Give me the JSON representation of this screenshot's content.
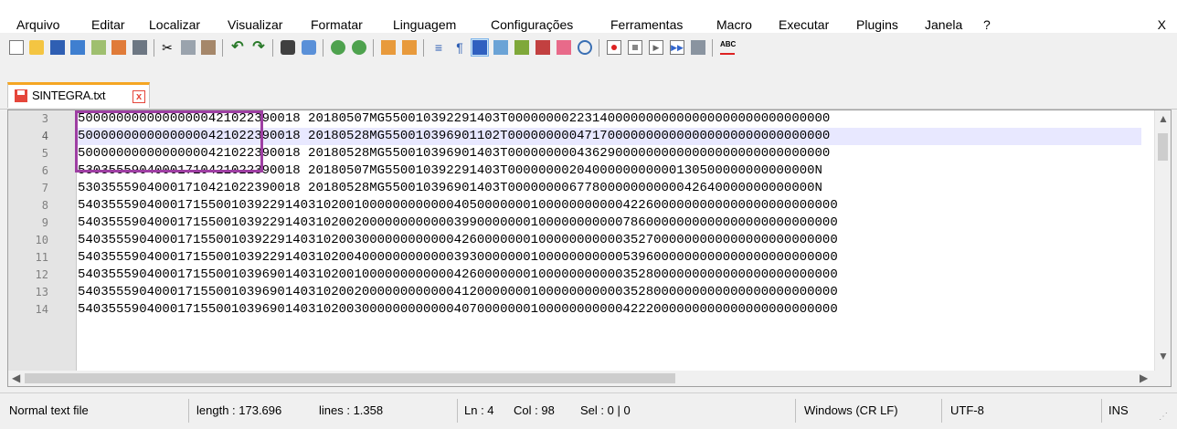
{
  "menu": {
    "items": [
      "Arquivo",
      "Editar",
      "Localizar",
      "Visualizar",
      "Formatar",
      "Linguagem",
      "Configurações",
      "Ferramentas",
      "Macro",
      "Executar",
      "Plugins",
      "Janela",
      "?"
    ],
    "close": "X"
  },
  "toolbar": {
    "icons": [
      "new-file-icon",
      "open-file-icon",
      "save-icon",
      "save-all-icon",
      "close-icon",
      "close-all-icon",
      "print-icon",
      "cut-icon",
      "copy-icon",
      "paste-icon",
      "undo-icon",
      "redo-icon",
      "find-icon",
      "replace-icon",
      "zoom-in-icon",
      "zoom-out-icon",
      "sync-vertical-icon",
      "sync-horizontal-icon",
      "word-wrap-icon",
      "show-all-characters-icon",
      "indent-guide-icon",
      "document-map-icon",
      "user-language-icon",
      "function-list-icon",
      "folder-workspace-icon",
      "monitoring-icon",
      "record-macro-icon",
      "stop-macro-icon",
      "play-macro-icon",
      "run-macro-multiple-icon",
      "save-macro-icon",
      "spell-check-icon"
    ]
  },
  "tab": {
    "label": "SINTEGRA.txt",
    "close": "x"
  },
  "editor": {
    "current_line": 4,
    "lines": [
      {
        "num": "3",
        "text": "50000000000000000421022390018 20180507MG550010392291403T000000002231400000000000000000000000000000"
      },
      {
        "num": "4",
        "text": "50000000000000000421022390018 20180528MG550010396901102T000000000471700000000000000000000000000000"
      },
      {
        "num": "5",
        "text": "50000000000000000421022390018 20180528MG550010396901403T000000000436290000000000000000000000000000"
      },
      {
        "num": "6",
        "text": "53035559040001710421022390018 20180507MG550010392291403T0000000020400000000000130500000000000000N"
      },
      {
        "num": "7",
        "text": "53035559040001710421022390018 20180528MG550010396901403T0000000067780000000000042640000000000000N"
      },
      {
        "num": "8",
        "text": "540355590400017155001039229140310200100000000000040500000001000000000004226000000000000000000000000"
      },
      {
        "num": "9",
        "text": "540355590400017155001039229140310200200000000000039900000001000000000007860000000000000000000000000"
      },
      {
        "num": "10",
        "text": "540355590400017155001039229140310200300000000000042600000001000000000003527000000000000000000000000"
      },
      {
        "num": "11",
        "text": "540355590400017155001039229140310200400000000000039300000001000000000005396000000000000000000000000"
      },
      {
        "num": "12",
        "text": "540355590400017155001039690140310200100000000000042600000001000000000003528000000000000000000000000"
      },
      {
        "num": "13",
        "text": "540355590400017155001039690140310200200000000000041200000001000000000003528000000000000000000000000"
      },
      {
        "num": "14",
        "text": "540355590400017155001039690140310200300000000000040700000001000000000004222000000000000000000000000"
      }
    ]
  },
  "status": {
    "filetype": "Normal text file",
    "length": "length : 173.696",
    "lines": "lines : 1.358",
    "ln": "Ln : 4",
    "col": "Col : 98",
    "sel": "Sel : 0 | 0",
    "eol": "Windows (CR LF)",
    "encoding": "UTF-8",
    "mode": "INS"
  },
  "colors": {
    "highlight_box": "#9e3fa3",
    "current_line": "#e8e8ff",
    "gutter": "#e4e4e4",
    "tab_accent": "#f5a623"
  }
}
